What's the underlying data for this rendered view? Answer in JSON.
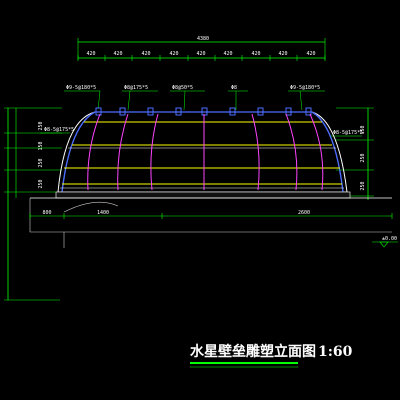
{
  "drawing": {
    "title": "水星壁垒雕塑立面图",
    "scale": "1:60",
    "overall_width": "4380",
    "segments": [
      "420",
      "420",
      "420",
      "420",
      "420",
      "420",
      "420",
      "420",
      "420"
    ],
    "callouts": [
      "Φ9-5@180*5",
      "Φ8@175*5",
      "Φ8@50*5",
      "Φ8",
      "Φ9-5@180*5"
    ],
    "left_dims": [
      "250",
      "150",
      "250",
      "250"
    ],
    "left_callout": "Φ8-5@175*5",
    "right_dims": [
      "150",
      "250",
      "250"
    ],
    "right_callout": "Φ8-5@175*5",
    "ground_dims": [
      "800",
      "1400",
      "2600"
    ],
    "elevation": "±0.00"
  },
  "colors": {
    "background": "#000000",
    "dimension_lines": "#00ff00",
    "contour_lines": "#ffffff",
    "ribs": "#ff44ff",
    "rebar": "#ffff00",
    "anchors": "#4d6dff",
    "base": "#cccccc",
    "title_underline": "#00ff00"
  }
}
